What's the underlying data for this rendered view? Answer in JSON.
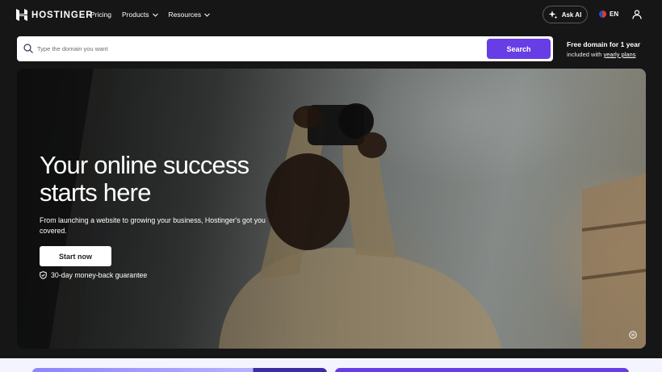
{
  "header": {
    "brand": "HOSTINGER",
    "nav": [
      {
        "label": "Pricing",
        "has_dropdown": false
      },
      {
        "label": "Products",
        "has_dropdown": true
      },
      {
        "label": "Resources",
        "has_dropdown": true
      }
    ],
    "ask_ai_label": "Ask AI",
    "language": "EN",
    "icons": [
      "hostinger-logo-icon",
      "sparkle-icon",
      "flag-icon",
      "user-icon",
      "chevron-down-icon"
    ]
  },
  "search": {
    "placeholder": "Type the domain you want",
    "button_label": "Search",
    "promo_title": "Free domain for 1 year",
    "promo_prefix": "included with",
    "promo_link": "yearly plans",
    "icons": [
      "search-icon"
    ]
  },
  "hero": {
    "title_line1": "Your online success",
    "title_line2": "starts here",
    "subtitle": "From launching a website to growing your business, Hostinger's got you covered.",
    "cta_label": "Start now",
    "guarantee": "30-day money-back guarantee",
    "icons": [
      "shield-check-icon",
      "pause-icon"
    ]
  },
  "colors": {
    "page_bg": "#161617",
    "accent": "#673de6",
    "light_strip": "#f4f4ff"
  }
}
